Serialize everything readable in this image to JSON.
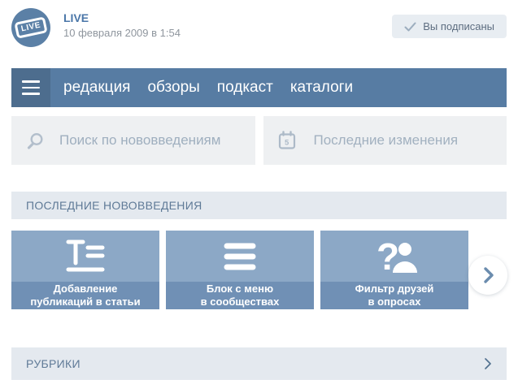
{
  "header": {
    "avatar_badge": "LIVE",
    "title": "LIVE",
    "date": "10 февраля 2009 в 1:54",
    "subscribed_label": "Вы подписаны"
  },
  "navbar": {
    "items": [
      {
        "label": "редакция"
      },
      {
        "label": "обзоры"
      },
      {
        "label": "подкаст"
      },
      {
        "label": "каталоги"
      }
    ]
  },
  "toolbar": {
    "search_placeholder": "Поиск по нововведениям",
    "search_value": "",
    "changes_label": "Последние изменения",
    "calendar_day": "5"
  },
  "sections": {
    "latest_title": "ПОСЛЕДНИЕ НОВОВВЕДЕНИЯ",
    "rubrics_title": "РУБРИКИ"
  },
  "cards": [
    {
      "icon": "article-icon",
      "lines": [
        "Добавление",
        "публикаций в статьи"
      ]
    },
    {
      "icon": "menu-icon",
      "lines": [
        "Блок с меню",
        "в сообществах"
      ]
    },
    {
      "icon": "poll-friends-icon",
      "lines": [
        "Фильтр друзей",
        "в опросах"
      ],
      "question_glyph": "?"
    }
  ],
  "colors": {
    "navbar_blue": "#577ca3",
    "burger_blue": "#4d6d8e",
    "avatar_blue": "#5b80a6",
    "title_blue": "#4a76a8",
    "card_top_blue": "#8ca8c6",
    "card_strip_blue": "#7090b5",
    "section_bar_bg": "#e4e9ef",
    "section_text": "#5f7a97",
    "field_bg": "#eef0f2",
    "subscribed_bg": "#e8edf2",
    "muted_text": "#9fafbf"
  }
}
